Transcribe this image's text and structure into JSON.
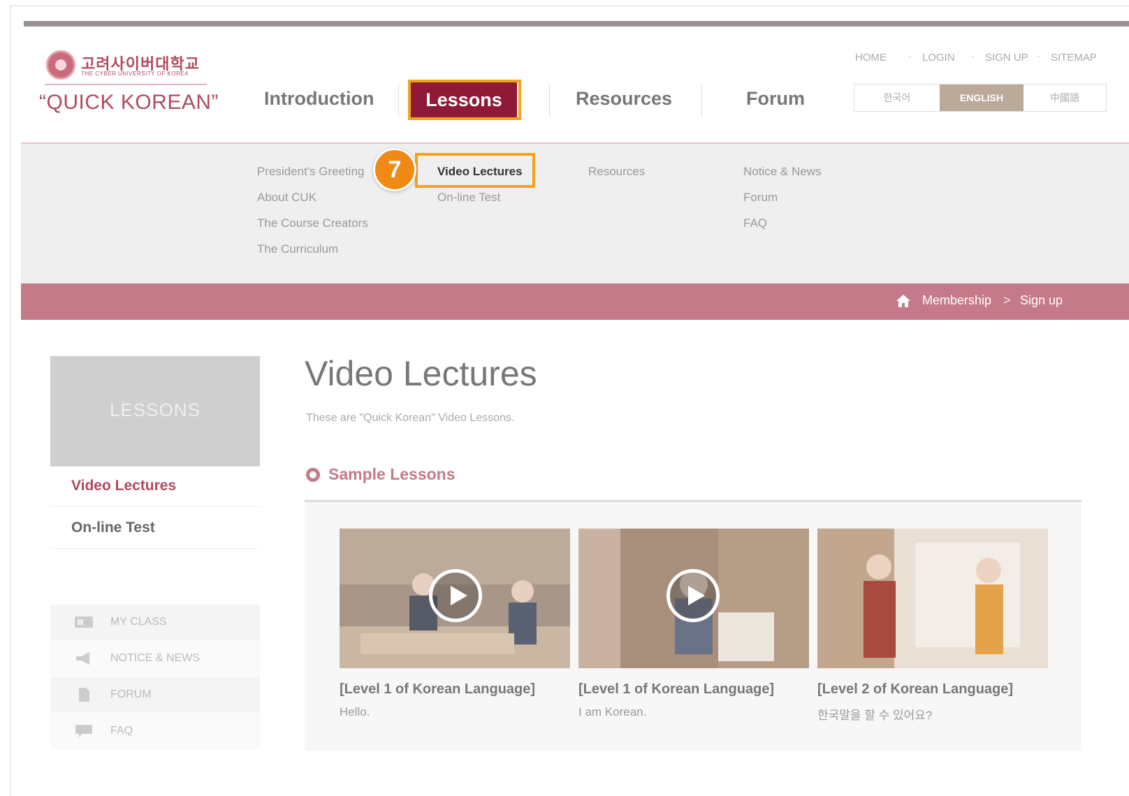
{
  "logo": {
    "korean_name": "고려사이버대학교",
    "english_name": "THE CYBER UNIVERSITY OF KOREA",
    "brand": "“QUICK KOREAN”"
  },
  "util_nav": [
    "HOME",
    "LOGIN",
    "SIGN UP",
    "SITEMAP"
  ],
  "languages": [
    {
      "label": "한국어",
      "active": false
    },
    {
      "label": "ENGLISH",
      "active": true
    },
    {
      "label": "中國語",
      "active": false
    }
  ],
  "main_nav": {
    "introduction": "Introduction",
    "lessons": "Lessons",
    "resources": "Resources",
    "forum": "Forum"
  },
  "mega_menu": {
    "introduction": [
      "President's Greeting",
      "About CUK",
      "The Course Creators",
      "The Curriculum"
    ],
    "lessons": [
      "Video Lectures",
      "On-line Test"
    ],
    "resources": [
      "Resources"
    ],
    "forum": [
      "Notice & News",
      "Forum",
      "FAQ"
    ]
  },
  "step_badge": "7",
  "breadcrumb": {
    "parent": "Membership",
    "separator": ">",
    "current": "Sign up"
  },
  "sidebar": {
    "header": "LESSONS",
    "links": [
      {
        "label": "Video Lectures",
        "active": true
      },
      {
        "label": "On-line Test",
        "active": false
      }
    ],
    "quick_links": [
      {
        "label": "MY CLASS",
        "icon": "class-icon"
      },
      {
        "label": "NOTICE & NEWS",
        "icon": "megaphone-icon"
      },
      {
        "label": "FORUM",
        "icon": "document-icon"
      },
      {
        "label": "FAQ",
        "icon": "chat-bubble-icon"
      }
    ]
  },
  "content": {
    "title": "Video Lectures",
    "description": "These are \"Quick Korean\" Video Lessons.",
    "section_title": "Sample Lessons",
    "videos": [
      {
        "title": "[Level 1 of Korean Language]",
        "subtitle": "Hello."
      },
      {
        "title": "[Level 1 of Korean Language]",
        "subtitle": "I am Korean."
      },
      {
        "title": "[Level 2 of Korean Language]",
        "subtitle": "한국말을 할 수 있어요?"
      }
    ]
  },
  "colors": {
    "brand": "#b04a5e",
    "lessons_active": "#8e1a37",
    "breadcrumb_bar": "#c47a89",
    "highlight": "#f3a21d",
    "badge": "#f08a15"
  }
}
